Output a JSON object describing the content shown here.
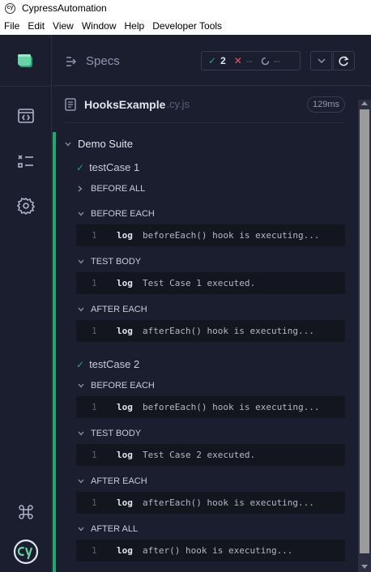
{
  "window": {
    "title": "CypressAutomation",
    "app_icon": "cy"
  },
  "menu": [
    "File",
    "Edit",
    "View",
    "Window",
    "Help",
    "Developer Tools"
  ],
  "topbar": {
    "specs_label": "Specs",
    "passed": "2",
    "failed": "--",
    "pending": "--"
  },
  "spec": {
    "name": "HooksExample",
    "ext": ".cy.js",
    "duration": "129ms"
  },
  "suite": {
    "title": "Demo Suite"
  },
  "tests": [
    {
      "title": "testCase 1",
      "before_all": "BEFORE ALL",
      "sections": [
        {
          "label": "BEFORE EACH",
          "num": "1",
          "kw": "log",
          "msg": "beforeEach() hook is executing..."
        },
        {
          "label": "TEST BODY",
          "num": "1",
          "kw": "log",
          "msg": "Test Case 1 executed."
        },
        {
          "label": "AFTER EACH",
          "num": "1",
          "kw": "log",
          "msg": "afterEach() hook is executing..."
        }
      ]
    },
    {
      "title": "testCase 2",
      "sections": [
        {
          "label": "BEFORE EACH",
          "num": "1",
          "kw": "log",
          "msg": "beforeEach() hook is executing..."
        },
        {
          "label": "TEST BODY",
          "num": "1",
          "kw": "log",
          "msg": "Test Case 2 executed."
        },
        {
          "label": "AFTER EACH",
          "num": "1",
          "kw": "log",
          "msg": "afterEach() hook is executing..."
        },
        {
          "label": "AFTER ALL",
          "num": "1",
          "kw": "log",
          "msg": "after() hook is executing..."
        }
      ]
    }
  ],
  "colors": {
    "pass": "#1fa971",
    "fail": "#e45770",
    "accent": "#2fd39e",
    "bg": "#1b1e2e"
  },
  "icons": [
    "runs-icon",
    "specs-icon",
    "test-list-icon",
    "settings-icon",
    "keyboard-shortcuts-icon",
    "cypress-logo-icon"
  ]
}
